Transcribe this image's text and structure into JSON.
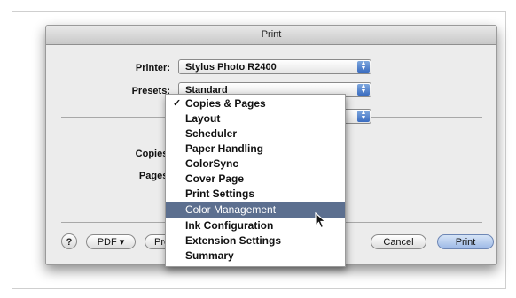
{
  "window": {
    "title": "Print"
  },
  "printer": {
    "label": "Printer:",
    "value": "Stylus Photo R2400"
  },
  "presets": {
    "label": "Presets:",
    "value": "Standard"
  },
  "copies_label": "Copies:",
  "pages_label": "Pages:",
  "menu": {
    "items": [
      {
        "label": "Copies & Pages",
        "checked": true
      },
      {
        "label": "Layout"
      },
      {
        "label": "Scheduler"
      },
      {
        "label": "Paper Handling"
      },
      {
        "label": "ColorSync"
      },
      {
        "label": "Cover Page"
      },
      {
        "label": "Print Settings"
      },
      {
        "label": "Color Management",
        "highlighted": true
      },
      {
        "label": "Ink Configuration"
      },
      {
        "label": "Extension Settings"
      },
      {
        "label": "Summary"
      }
    ],
    "check_mark": "✓"
  },
  "footer": {
    "help_label": "?",
    "pdf_label": "PDF ▾",
    "preview_label": "Prev",
    "cancel_label": "Cancel",
    "print_label": "Print"
  },
  "colors": {
    "highlight": "#5c6f8f",
    "default_button": "#9db9e6",
    "stepper": "#3a6cc0"
  },
  "icons": {
    "stepper": "stepper-arrows-icon",
    "cursor": "mouse-pointer-icon"
  }
}
